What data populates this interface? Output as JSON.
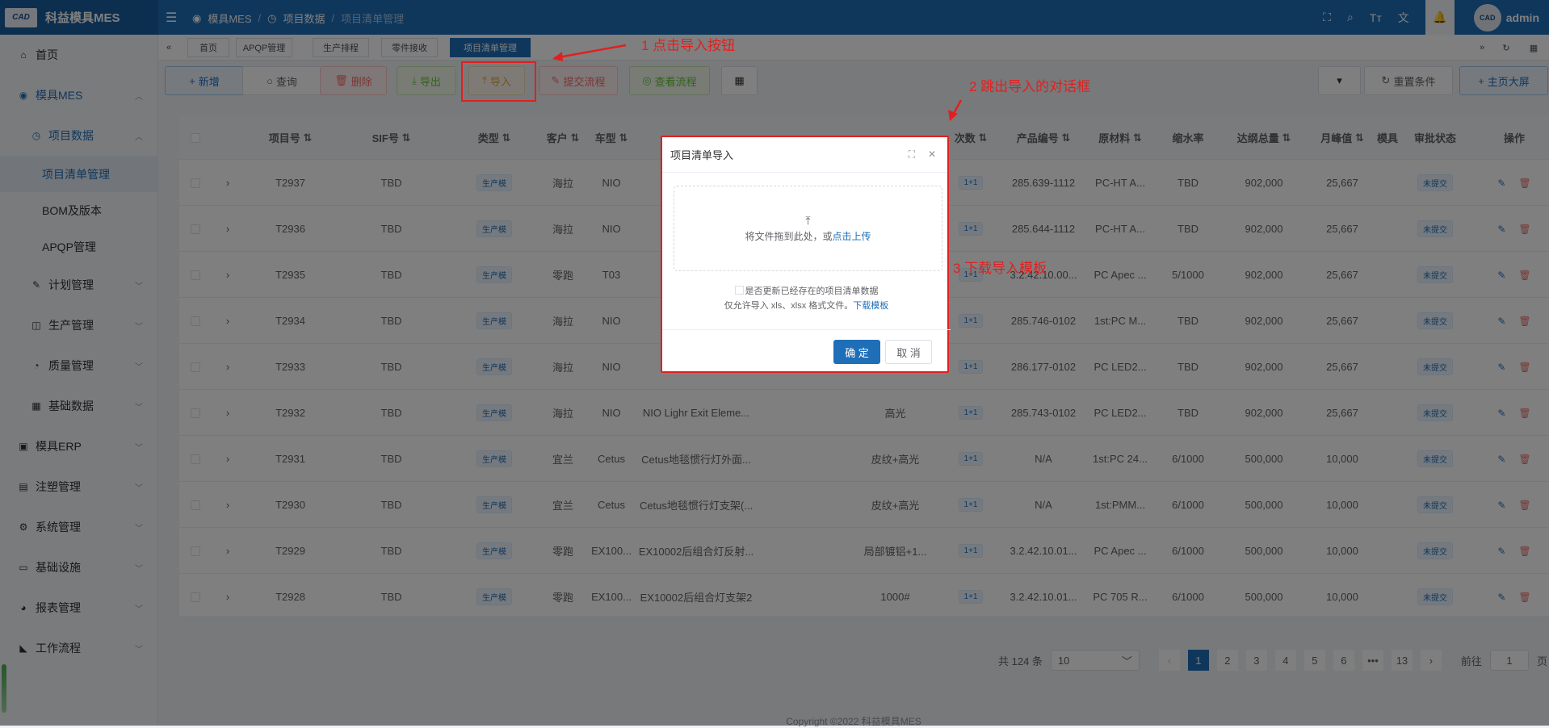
{
  "app": {
    "logo_badge": "CAD",
    "title": "科益模具MES"
  },
  "header": {
    "breadcrumb": [
      "模具MES",
      "项目数据",
      "项目清单管理"
    ],
    "user": "admin",
    "avatar": "CAD"
  },
  "sidebar": {
    "items": [
      {
        "label": "首页",
        "icon": "home-icon"
      },
      {
        "label": "模具MES",
        "icon": "camera-icon"
      },
      {
        "label": "项目数据",
        "icon": "clock-icon"
      },
      {
        "label": "项目清单管理"
      },
      {
        "label": "BOM及版本"
      },
      {
        "label": "APQP管理"
      },
      {
        "label": "计划管理",
        "icon": "edit-icon"
      },
      {
        "label": "生产管理",
        "icon": "bag-icon"
      },
      {
        "label": "质量管理",
        "icon": "timer-icon"
      },
      {
        "label": "基础数据",
        "icon": "calendar-icon"
      },
      {
        "label": "模具ERP",
        "icon": "cart-icon"
      },
      {
        "label": "注塑管理",
        "icon": "box-icon"
      },
      {
        "label": "系统管理",
        "icon": "gear-icon"
      },
      {
        "label": "基础设施",
        "icon": "monitor-icon"
      },
      {
        "label": "报表管理",
        "icon": "pie-icon"
      },
      {
        "label": "工作流程",
        "icon": "flow-icon"
      }
    ]
  },
  "tags": [
    "首页",
    "APQP管理",
    "生产排程",
    "零件接收",
    "项目清单管理"
  ],
  "toolbar": {
    "add": "新增",
    "query": "查询",
    "delete": "删除",
    "export": "导出",
    "import": "导入",
    "submit_flow": "提交流程",
    "view_flow": "查看流程",
    "reset": "重置条件",
    "bigscreen": "主页大屏"
  },
  "annotations": {
    "a1": "1 点击导入按钮",
    "a2": "2 跳出导入的对话框",
    "a3": "3 下载导入模板"
  },
  "table": {
    "headers": [
      "项目号",
      "SIF号",
      "类型",
      "客户",
      "车型",
      "",
      "",
      "",
      "次数",
      "产品编号",
      "原材料",
      "缩水率",
      "达纲总量",
      "月峰值",
      "模具",
      "审批状态",
      "操作"
    ],
    "rows": [
      {
        "proj": "T2937",
        "sif": "TBD",
        "type": "生产模",
        "cust": "海拉",
        "model": "NIO",
        "name": "",
        "finish": "",
        "times": "1+1",
        "pno": "285.639-1112",
        "mat": "PC-HT A...",
        "shrink": "TBD",
        "total": "902,000",
        "peak": "25,667",
        "status": "未提交"
      },
      {
        "proj": "T2936",
        "sif": "TBD",
        "type": "生产模",
        "cust": "海拉",
        "model": "NIO",
        "name": "N",
        "finish": "",
        "times": "1+1",
        "pno": "285.644-1112",
        "mat": "PC-HT A...",
        "shrink": "TBD",
        "total": "902,000",
        "peak": "25,667",
        "status": "未提交"
      },
      {
        "proj": "T2935",
        "sif": "TBD",
        "type": "生产模",
        "cust": "零跑",
        "model": "T03",
        "name": "",
        "finish": "",
        "times": "1+1",
        "pno": "3.2.42.10.00...",
        "mat": "PC Apec ...",
        "shrink": "5/1000",
        "total": "902,000",
        "peak": "25,667",
        "status": "未提交"
      },
      {
        "proj": "T2934",
        "sif": "TBD",
        "type": "生产模",
        "cust": "海拉",
        "model": "NIO",
        "name": "N",
        "finish": "",
        "times": "1+1",
        "pno": "285.746-0102",
        "mat": "1st:PC M...",
        "shrink": "TBD",
        "total": "902,000",
        "peak": "25,667",
        "status": "未提交"
      },
      {
        "proj": "T2933",
        "sif": "TBD",
        "type": "生产模",
        "cust": "海拉",
        "model": "NIO",
        "name": "NIO",
        "finish": "",
        "times": "1+1",
        "pno": "286.177-0102",
        "mat": "PC LED2...",
        "shrink": "TBD",
        "total": "902,000",
        "peak": "25,667",
        "status": "未提交"
      },
      {
        "proj": "T2932",
        "sif": "TBD",
        "type": "生产模",
        "cust": "海拉",
        "model": "NIO",
        "name": "NIO Lighr Exit Eleme...",
        "finish": "高光",
        "times": "1+1",
        "pno": "285.743-0102",
        "mat": "PC LED2...",
        "shrink": "TBD",
        "total": "902,000",
        "peak": "25,667",
        "status": "未提交"
      },
      {
        "proj": "T2931",
        "sif": "TBD",
        "type": "生产模",
        "cust": "宜兰",
        "model": "Cetus",
        "name": "Cetus地毯惯行灯外面...",
        "finish": "皮纹+高光",
        "times": "1+1",
        "pno": "N/A",
        "mat": "1st:PC 24...",
        "shrink": "6/1000",
        "total": "500,000",
        "peak": "10,000",
        "status": "未提交"
      },
      {
        "proj": "T2930",
        "sif": "TBD",
        "type": "生产模",
        "cust": "宜兰",
        "model": "Cetus",
        "name": "Cetus地毯惯行灯支架(...",
        "finish": "皮纹+高光",
        "times": "1+1",
        "pno": "N/A",
        "mat": "1st:PMM...",
        "shrink": "6/1000",
        "total": "500,000",
        "peak": "10,000",
        "status": "未提交"
      },
      {
        "proj": "T2929",
        "sif": "TBD",
        "type": "生产模",
        "cust": "零跑",
        "model": "EX100...",
        "name": "EX10002后组合灯反射...",
        "finish": "局部镀铝+1...",
        "times": "1+1",
        "pno": "3.2.42.10.01...",
        "mat": "PC Apec ...",
        "shrink": "6/1000",
        "total": "500,000",
        "peak": "10,000",
        "status": "未提交"
      },
      {
        "proj": "T2928",
        "sif": "TBD",
        "type": "生产模",
        "cust": "零跑",
        "model": "EX100...",
        "name": "EX10002后组合灯支架2",
        "finish": "1000#",
        "times": "1+1",
        "pno": "3.2.42.10.01...",
        "mat": "PC 705 R...",
        "shrink": "6/1000",
        "total": "500,000",
        "peak": "10,000",
        "status": "未提交"
      }
    ]
  },
  "pager": {
    "total": "共 124 条",
    "size": "10",
    "pages": [
      "1",
      "2",
      "3",
      "4",
      "5",
      "6",
      "•••",
      "13"
    ],
    "goto": "前往",
    "goto_val": "1",
    "unit": "页"
  },
  "footer": "Copyright ©2022 科益模具MES",
  "dialog": {
    "title": "项目清单导入",
    "drag": "将文件拖到此处，或",
    "click_upload": "点击上传",
    "update_label": "是否更新已经存在的项目清单数据",
    "allow": "仅允许导入 xls、xlsx 格式文件。",
    "download": "下载模板",
    "ok": "确 定",
    "cancel": "取 消"
  }
}
